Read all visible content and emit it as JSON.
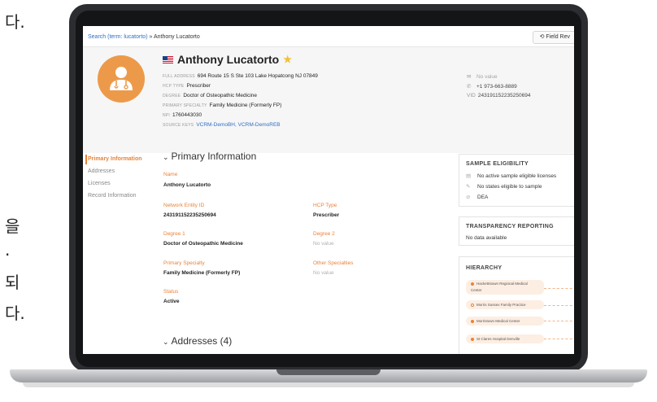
{
  "side_text": [
    "다.",
    "을",
    ".",
    "되",
    "다."
  ],
  "breadcrumb": {
    "search_link": "Search (term: lucatorto)",
    "separator": "»",
    "current": "Anthony Lucatorto"
  },
  "field_button_label": "Field Rev",
  "profile": {
    "name": "Anthony Lucatorto",
    "fields": [
      {
        "key": "FULL ADDRESS",
        "value": "694 Route 15 S Ste 103 Lake Hopatcong NJ 07849"
      },
      {
        "key": "HCP TYPE",
        "value": "Prescriber"
      },
      {
        "key": "DEGREE",
        "value": "Doctor of Osteopathic Medicine"
      },
      {
        "key": "PRIMARY SPECIALTY",
        "value": "Family Medicine (Formerly FP)"
      },
      {
        "key": "NPI",
        "value": "1760443030"
      },
      {
        "key": "SOURCE KEYS",
        "value": "VCRM-DemoBH, VCRM-DemoREB"
      }
    ],
    "contact": {
      "email": "No value",
      "phone": "+1 973-663-8889",
      "vid_label": "VID",
      "vid": "243191152235250694"
    }
  },
  "nav": {
    "items": [
      "Primary Information",
      "Addresses",
      "Licenses",
      "Record Information"
    ],
    "active_index": 0
  },
  "primary_info": {
    "title": "Primary Information",
    "fields": {
      "name": {
        "label": "Name",
        "value": "Anthony Lucatorto"
      },
      "network_entity_id": {
        "label": "Network Entity ID",
        "value": "243191152235250694"
      },
      "hcp_type": {
        "label": "HCP Type",
        "value": "Prescriber"
      },
      "degree_1": {
        "label": "Degree 1",
        "value": "Doctor of Osteopathic Medicine"
      },
      "degree_2": {
        "label": "Degree 2",
        "value": "No value"
      },
      "primary_specialty": {
        "label": "Primary Specialty",
        "value": "Family Medicine (Formerly FP)"
      },
      "other_specialties": {
        "label": "Other Specialties",
        "value": "No value"
      },
      "status": {
        "label": "Status",
        "value": "Active"
      }
    }
  },
  "addresses": {
    "title": "Addresses (4)"
  },
  "sample_eligibility": {
    "title": "SAMPLE ELIGIBILITY",
    "rows": [
      "No active sample eligible licenses",
      "No states eligible to sample",
      "DEA"
    ]
  },
  "transparency": {
    "title": "TRANSPARENCY REPORTING",
    "text": "No data available"
  },
  "hierarchy": {
    "title": "HIERARCHY",
    "nodes": [
      "Hackettstown Regional Medical Center",
      "Morris Sussex Family Practice",
      "Morristown Medical Center",
      "St Clares Hospital Denville"
    ]
  },
  "colors": {
    "accent": "#e8833a",
    "link": "#2f6fc4",
    "avatar": "#ec9a4a",
    "star": "#f2c034"
  }
}
